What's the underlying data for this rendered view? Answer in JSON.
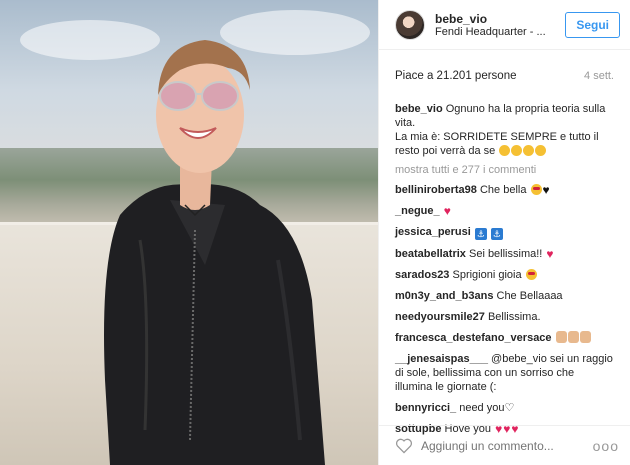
{
  "header": {
    "username": "bebe_vio",
    "location": "Fendi Headquarter - ...",
    "follow_label": "Segui"
  },
  "likes": "Piace a 21.201 persone",
  "time": "4 sett.",
  "caption": {
    "user": "bebe_vio",
    "text_1": "Ognuno ha la propria teoria sulla vita.",
    "text_2": "La mia è: SORRIDETE SEMPRE e tutto il resto poi verrà da se"
  },
  "load_more": "mostra tutti e 277 i commenti",
  "comments": [
    {
      "user": "belliniroberta98",
      "text": "Che bella"
    },
    {
      "user": "_negue_",
      "text": ""
    },
    {
      "user": "jessica_perusi",
      "text": ""
    },
    {
      "user": "beatabellatrix",
      "text": "Sei bellissima!!"
    },
    {
      "user": "sarados23",
      "text": "Sprigioni gioia"
    },
    {
      "user": "m0n3y_and_b3ans",
      "text": "Che Bellaaaa"
    },
    {
      "user": "needyoursmile27",
      "text": "Bellissima."
    },
    {
      "user": "francesca_destefano_versace",
      "text": ""
    },
    {
      "user": "__jenesaispas___",
      "text": "@bebe_vio sei un raggio di sole, bellissima con un sorriso che illumina le giornate (:"
    },
    {
      "user": "bennyricci_",
      "text": "need you♡"
    },
    {
      "user": "sottupbe",
      "text": "Hove you"
    }
  ],
  "footer": {
    "placeholder": "Aggiungi un commento...",
    "more": "ooo"
  },
  "colors": {
    "accent": "#3897f0",
    "heart": "#e0245e"
  }
}
